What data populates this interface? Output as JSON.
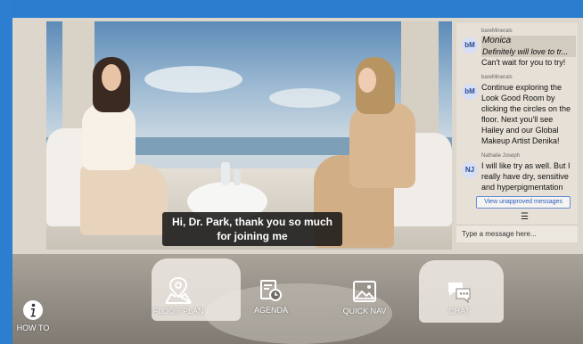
{
  "caption": {
    "line1": "Hi, Dr. Park, thank you so much",
    "line2": "for joining me"
  },
  "chat": {
    "messages": [
      {
        "avatar": "bM",
        "sender": "bareMinerals",
        "quote_name": "Monica",
        "quote_text": "Definitely will love to tr...",
        "text": "Can't wait for you to try!"
      },
      {
        "avatar": "bM",
        "sender": "bareMinerals",
        "text": "Continue exploring the Look Good Room by clicking the circles on the floor. Next you'll see Hailey and our Global Makeup Artist Denika!"
      },
      {
        "avatar": "NJ",
        "sender": "Nathalie Joseph",
        "text": "I will like try as well. But I really have dry, sensitive and hyperpigmentation"
      }
    ],
    "unapproved_label": "View unapproved messages",
    "menu_icon": "hamburger-icon",
    "input_placeholder": "Type a message here..."
  },
  "nav": {
    "how_to": "HOW TO",
    "floor_plan": "FLOOR PLAN",
    "agenda": "AGENDA",
    "quick_nav": "QUICK NAV",
    "chat": "CHAT"
  },
  "icons": {
    "how_to": "info-icon",
    "floor_plan": "map-pin-icon",
    "agenda": "calendar-clock-icon",
    "quick_nav": "image-icon",
    "chat": "chat-bubbles-icon"
  },
  "colors": {
    "accent_blue": "#2a7dcf",
    "link_blue": "#2a5cc0",
    "chat_panel": "#e6e0d6"
  }
}
